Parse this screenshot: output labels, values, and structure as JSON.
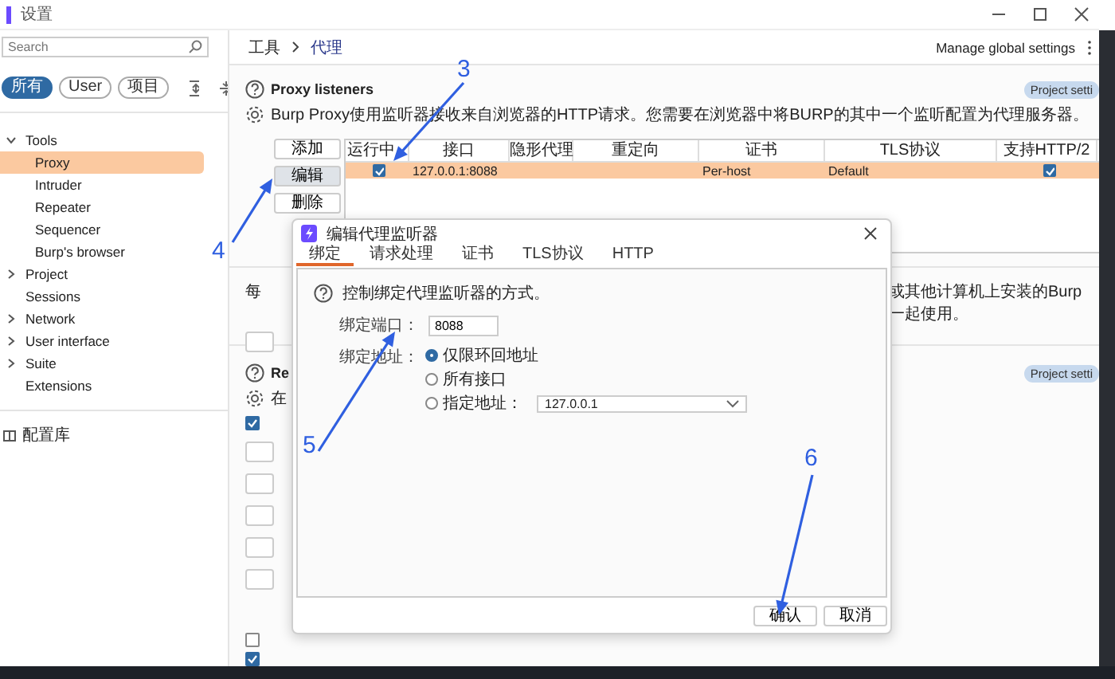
{
  "window": {
    "title": "设置"
  },
  "sidebar": {
    "search": {
      "placeholder": "Search"
    },
    "filters": [
      {
        "label": "所有",
        "selected": true
      },
      {
        "label": "User",
        "selected": false
      },
      {
        "label": "项目",
        "selected": false
      }
    ],
    "tree": [
      {
        "label": "Tools",
        "kind": "folder",
        "expanded": true,
        "children": [
          {
            "label": "Proxy",
            "selected": true
          },
          {
            "label": "Intruder",
            "selected": false
          },
          {
            "label": "Repeater",
            "selected": false
          },
          {
            "label": "Sequencer",
            "selected": false
          },
          {
            "label": "Burp's browser",
            "selected": false
          }
        ]
      },
      {
        "label": "Project",
        "kind": "folder",
        "expanded": false
      },
      {
        "label": "Sessions",
        "kind": "leaf"
      },
      {
        "label": "Network",
        "kind": "folder",
        "expanded": false
      },
      {
        "label": "User interface",
        "kind": "folder",
        "expanded": false
      },
      {
        "label": "Suite",
        "kind": "folder",
        "expanded": false
      },
      {
        "label": "Extensions",
        "kind": "leaf"
      }
    ],
    "library": "配置库"
  },
  "breadcrumb": [
    "工具",
    "代理"
  ],
  "global_settings": "Manage global settings",
  "proxy_listeners": {
    "title": "Proxy listeners",
    "description": "Burp Proxy使用监听器接收来自浏览器的HTTP请求。您需要在浏览器中将BURP的其中一个监听配置为代理服务器。",
    "badge": "Project setti",
    "buttons": [
      "添加",
      "编辑",
      "删除"
    ],
    "table": {
      "columns": [
        "运行中",
        "接口",
        "隐形代理",
        "重定向",
        "证书",
        "TLS协议",
        "支持HTTP/2"
      ],
      "rows": [
        {
          "running": true,
          "interface": "127.0.0.1:8088",
          "certificate": "Per-host",
          "tls": "Default",
          "http2": true,
          "selected": true
        }
      ]
    }
  },
  "covered_section": {
    "text_start": "每",
    "text_end": "或其他计算机上安装的Burp一起使用。"
  },
  "second_section": {
    "title": "Re",
    "description": "在",
    "badge": "Project setti",
    "rows": [
      {
        "kind": "checkbox",
        "checked": true
      },
      {
        "kind": "box"
      },
      {
        "kind": "box"
      },
      {
        "kind": "box"
      },
      {
        "kind": "box"
      },
      {
        "kind": "box"
      },
      {
        "kind": "checkbox",
        "checked": false
      },
      {
        "kind": "checkbox",
        "checked": true
      }
    ]
  },
  "dialog": {
    "title": "编辑代理监听器",
    "tabs": [
      {
        "label": "绑定",
        "selected": true
      },
      {
        "label": "请求处理",
        "selected": false
      },
      {
        "label": "证书",
        "selected": false
      },
      {
        "label": "TLS协议",
        "selected": false
      },
      {
        "label": "HTTP",
        "selected": false
      }
    ],
    "help": "控制绑定代理监听器的方式。",
    "port_label": "绑定端口：",
    "port": "8088",
    "address_label": "绑定地址：",
    "address_options": [
      {
        "label": "仅限环回地址",
        "selected": true
      },
      {
        "label": "所有接口",
        "selected": false
      },
      {
        "label": "指定地址：",
        "selected": false
      }
    ],
    "specific_address": "127.0.0.1",
    "buttons": [
      "确认",
      "取消"
    ]
  },
  "annotations": [
    {
      "label": "3"
    },
    {
      "label": "4"
    },
    {
      "label": "5"
    },
    {
      "label": "6"
    }
  ]
}
